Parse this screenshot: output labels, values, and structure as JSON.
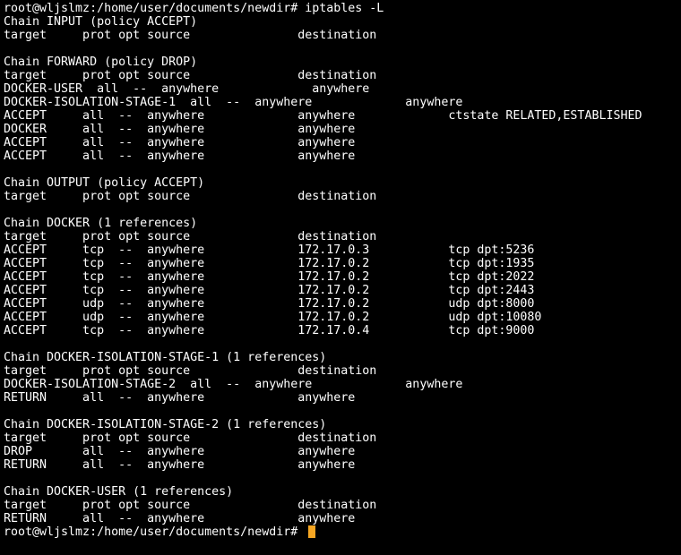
{
  "terminal": {
    "colors": {
      "background": "#000000",
      "foreground": "#ffffff",
      "cursor": "#f5a623"
    },
    "lines": [
      "root@wljslmz:/home/user/documents/newdir# iptables -L",
      "Chain INPUT (policy ACCEPT)",
      "target     prot opt source               destination",
      "",
      "Chain FORWARD (policy DROP)",
      "target     prot opt source               destination",
      "DOCKER-USER  all  --  anywhere             anywhere",
      "DOCKER-ISOLATION-STAGE-1  all  --  anywhere             anywhere",
      "ACCEPT     all  --  anywhere             anywhere             ctstate RELATED,ESTABLISHED",
      "DOCKER     all  --  anywhere             anywhere",
      "ACCEPT     all  --  anywhere             anywhere",
      "ACCEPT     all  --  anywhere             anywhere",
      "",
      "Chain OUTPUT (policy ACCEPT)",
      "target     prot opt source               destination",
      "",
      "Chain DOCKER (1 references)",
      "target     prot opt source               destination",
      "ACCEPT     tcp  --  anywhere             172.17.0.3           tcp dpt:5236",
      "ACCEPT     tcp  --  anywhere             172.17.0.2           tcp dpt:1935",
      "ACCEPT     tcp  --  anywhere             172.17.0.2           tcp dpt:2022",
      "ACCEPT     tcp  --  anywhere             172.17.0.2           tcp dpt:2443",
      "ACCEPT     udp  --  anywhere             172.17.0.2           udp dpt:8000",
      "ACCEPT     udp  --  anywhere             172.17.0.2           udp dpt:10080",
      "ACCEPT     tcp  --  anywhere             172.17.0.4           tcp dpt:9000",
      "",
      "Chain DOCKER-ISOLATION-STAGE-1 (1 references)",
      "target     prot opt source               destination",
      "DOCKER-ISOLATION-STAGE-2  all  --  anywhere             anywhere",
      "RETURN     all  --  anywhere             anywhere",
      "",
      "Chain DOCKER-ISOLATION-STAGE-2 (1 references)",
      "target     prot opt source               destination",
      "DROP       all  --  anywhere             anywhere",
      "RETURN     all  --  anywhere             anywhere",
      "",
      "Chain DOCKER-USER (1 references)",
      "target     prot opt source               destination",
      "RETURN     all  --  anywhere             anywhere"
    ],
    "prompt": "root@wljslmz:/home/user/documents/newdir# "
  }
}
